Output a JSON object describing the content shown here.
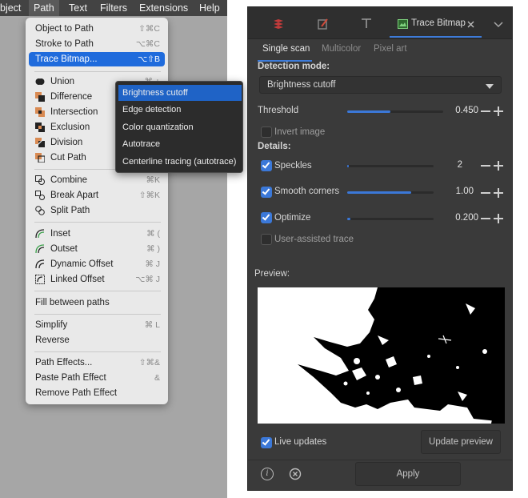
{
  "menubar": {
    "items": [
      "bject",
      "Path",
      "Text",
      "Filters",
      "Extensions",
      "Help"
    ]
  },
  "path_menu": {
    "groups": [
      [
        {
          "label": "Object to Path",
          "shortcut": "⇧⌘C"
        },
        {
          "label": "Stroke to Path",
          "shortcut": "⌥⌘C"
        },
        {
          "label": "Trace Bitmap...",
          "shortcut": "⌥⇧B"
        }
      ],
      [
        {
          "label": "Union",
          "shortcut": "⌘ +",
          "icon": "union-icon"
        },
        {
          "label": "Difference",
          "shortcut": "⌘ -",
          "icon": "difference-icon"
        },
        {
          "label": "Intersection",
          "shortcut": "⌘ *",
          "icon": "intersection-icon"
        },
        {
          "label": "Exclusion",
          "shortcut": "⌘ ^",
          "icon": "exclusion-icon"
        },
        {
          "label": "Division",
          "shortcut": "⌘ /",
          "icon": "division-icon"
        },
        {
          "label": "Cut Path",
          "shortcut": "⌥⌘ /",
          "icon": "cut-path-icon"
        }
      ],
      [
        {
          "label": "Combine",
          "shortcut": "⌘K",
          "icon": "combine-icon"
        },
        {
          "label": "Break Apart",
          "shortcut": "⇧⌘K",
          "icon": "break-apart-icon"
        },
        {
          "label": "Split Path",
          "shortcut": "",
          "icon": "split-path-icon"
        }
      ],
      [
        {
          "label": "Inset",
          "shortcut": "⌘ (",
          "icon": "inset-icon"
        },
        {
          "label": "Outset",
          "shortcut": "⌘ )",
          "icon": "outset-icon"
        },
        {
          "label": "Dynamic Offset",
          "shortcut": "⌘ J",
          "icon": "dynamic-offset-icon"
        },
        {
          "label": "Linked Offset",
          "shortcut": "⌥⌘ J",
          "icon": "linked-offset-icon"
        }
      ],
      [
        {
          "label": "Fill between paths",
          "shortcut": ""
        }
      ],
      [
        {
          "label": "Simplify",
          "shortcut": "⌘ L"
        },
        {
          "label": "Reverse",
          "shortcut": ""
        }
      ],
      [
        {
          "label": "Path Effects...",
          "shortcut": "⇧⌘&"
        },
        {
          "label": "Paste Path Effect",
          "shortcut": "&"
        },
        {
          "label": "Remove Path Effect",
          "shortcut": ""
        }
      ]
    ]
  },
  "submenu": {
    "items": [
      "Brightness cutoff",
      "Edge detection",
      "Color quantization",
      "Autotrace",
      "Centerline tracing (autotrace)"
    ]
  },
  "dialog": {
    "tab_title": "Trace Bitmap",
    "subtabs": [
      "Single scan",
      "Multicolor",
      "Pixel art"
    ],
    "detection_mode_label": "Detection mode:",
    "detection_mode_value": "Brightness cutoff",
    "threshold": {
      "label": "Threshold",
      "value": "0.450",
      "fraction": 0.45
    },
    "invert_image": {
      "label": "Invert image",
      "checked": false
    },
    "details_label": "Details:",
    "speckles": {
      "label": "Speckles",
      "value": "2",
      "checked": true,
      "fraction": 0.02
    },
    "smooth_corners": {
      "label": "Smooth corners",
      "value": "1.00",
      "checked": true,
      "fraction": 0.74
    },
    "optimize": {
      "label": "Optimize",
      "value": "0.200",
      "checked": true,
      "fraction": 0.04
    },
    "user_assisted": {
      "label": "User-assisted trace",
      "checked": false
    },
    "preview_label": "Preview:",
    "live_updates": {
      "label": "Live updates",
      "checked": true
    },
    "update_preview_label": "Update preview",
    "apply_label": "Apply",
    "accent_color": "#3b78d8"
  }
}
